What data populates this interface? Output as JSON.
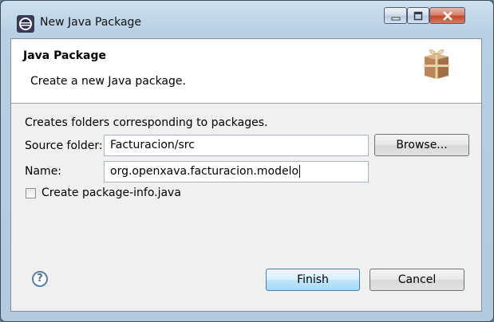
{
  "window": {
    "title": "New Java Package",
    "icon": "eclipse-icon"
  },
  "titlebar_controls": {
    "minimize_icon": "minimize-icon",
    "maximize_icon": "maximize-icon",
    "close_icon": "close-icon"
  },
  "banner": {
    "title": "Java Package",
    "description": "Create a new Java package.",
    "icon": "package-icon"
  },
  "form": {
    "intro": "Creates folders corresponding to packages.",
    "source_folder_label": "Source folder:",
    "source_folder_value": "Facturacion/src",
    "browse_label": "Browse...",
    "name_label": "Name:",
    "name_value": "org.openxava.facturacion.modelo",
    "checkbox_label": "Create package-info.java",
    "checkbox_checked": false
  },
  "footer": {
    "help_icon": "help-icon",
    "finish_label": "Finish",
    "cancel_label": "Cancel"
  },
  "colors": {
    "accent": "#3c7fb1",
    "titlebar": "#b9d0e4",
    "close": "#c4482b"
  }
}
